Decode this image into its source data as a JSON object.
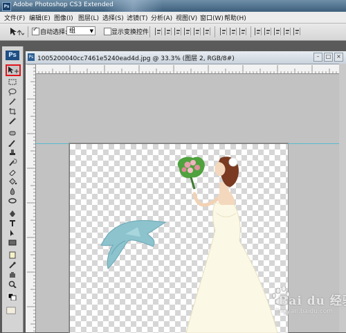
{
  "app": {
    "title": "Adobe Photoshop CS3 Extended",
    "logo": "Ps"
  },
  "menu": [
    "文件(F)",
    "编辑(E)",
    "图像(I)",
    "图层(L)",
    "选择(S)",
    "滤镜(T)",
    "分析(A)",
    "视图(V)",
    "窗口(W)",
    "帮助(H)"
  ],
  "options": {
    "auto_select_label": "自动选择:",
    "auto_select_checked": true,
    "auto_select_value": "组",
    "show_transform_label": "显示变换控件",
    "show_transform_checked": false
  },
  "document": {
    "title": "1005200040cc7461e5240ead4d.jpg @ 33.3% (图层 2, RGB/8#)"
  },
  "tools": [
    "move-tool",
    "marquee-tool",
    "lasso-tool",
    "magic-wand-tool",
    "crop-tool",
    "slice-tool",
    "healing-brush-tool",
    "brush-tool",
    "clone-stamp-tool",
    "history-brush-tool",
    "eraser-tool",
    "paint-bucket-tool",
    "blur-tool",
    "dodge-tool",
    "pen-tool",
    "type-tool",
    "path-selection-tool",
    "shape-tool",
    "notes-tool",
    "eyedropper-tool",
    "hand-tool",
    "zoom-tool",
    "color-swatches",
    "quick-mask"
  ],
  "watermark": {
    "main": "Bai du 经验",
    "sub": "jingyan.baidu.com"
  },
  "colors": {
    "highlight": "#e0141c",
    "guide": "#29b6d6",
    "ribbon": "#7fb8c4",
    "dress": "#fbf8e6"
  }
}
